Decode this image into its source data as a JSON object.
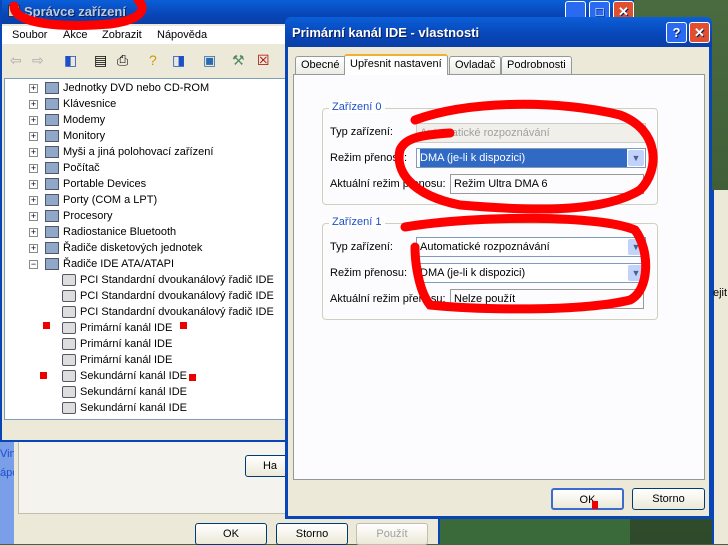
{
  "main_window": {
    "title": "Správce zařízení",
    "menu": [
      "Soubor",
      "Akce",
      "Zobrazit",
      "Nápověda"
    ],
    "tree": [
      {
        "label": "Jednotky DVD nebo CD-ROM",
        "level": 1
      },
      {
        "label": "Klávesnice",
        "level": 1
      },
      {
        "label": "Modemy",
        "level": 1
      },
      {
        "label": "Monitory",
        "level": 1
      },
      {
        "label": "Myši a jiná polohovací zařízení",
        "level": 1
      },
      {
        "label": "Počítač",
        "level": 1
      },
      {
        "label": "Portable Devices",
        "level": 1
      },
      {
        "label": "Porty (COM a LPT)",
        "level": 1
      },
      {
        "label": "Procesory",
        "level": 1
      },
      {
        "label": "Radiostanice Bluetooth",
        "level": 1
      },
      {
        "label": "Řadiče disketových jednotek",
        "level": 1
      },
      {
        "label": "Řadiče IDE ATA/ATAPI",
        "level": 1
      },
      {
        "label": "PCI Standardní dvoukanálový řadič IDE",
        "level": 2
      },
      {
        "label": "PCI Standardní dvoukanálový řadič IDE",
        "level": 2
      },
      {
        "label": "PCI Standardní dvoukanálový řadič IDE",
        "level": 2
      },
      {
        "label": "Primární kanál IDE",
        "level": 2
      },
      {
        "label": "Primární kanál IDE",
        "level": 2
      },
      {
        "label": "Primární kanál IDE",
        "level": 2
      },
      {
        "label": "Sekundární kanál IDE",
        "level": 2
      },
      {
        "label": "Sekundární kanál IDE",
        "level": 2
      },
      {
        "label": "Sekundární kanál IDE",
        "level": 2
      }
    ]
  },
  "back_dialog": {
    "ha_button": "Ha",
    "ok": "OK",
    "cancel": "Storno",
    "apply": "Použít",
    "side_text": [
      "Vind",
      "ápo"
    ],
    "right_text": "ejit"
  },
  "dialog": {
    "title": "Primární kanál IDE - vlastnosti",
    "tabs": [
      "Obecné",
      "Upřesnit nastavení",
      "Ovladač",
      "Podrobnosti"
    ],
    "active_tab": 1,
    "device0": {
      "title": "Zařízení 0",
      "type_label": "Typ zařízení:",
      "type_value": "Automatické rozpoznávání",
      "mode_label": "Režim přenosu:",
      "mode_value": "DMA (je-li k dispozici)",
      "current_label": "Aktuální režim přenosu:",
      "current_value": "Režim Ultra DMA 6"
    },
    "device1": {
      "title": "Zařízení 1",
      "type_label": "Typ zařízení:",
      "type_value": "Automatické rozpoznávání",
      "mode_label": "Režim přenosu:",
      "mode_value": "DMA (je-li k dispozici)",
      "current_label": "Aktuální režim přenosu:",
      "current_value": "Nelze použít"
    },
    "ok": "OK",
    "cancel": "Storno",
    "help": "?",
    "close": "✕"
  }
}
